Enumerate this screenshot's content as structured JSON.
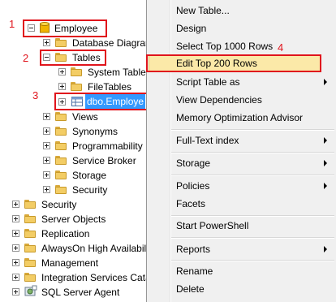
{
  "tree": {
    "employee_db": "Employee",
    "database_diagrams": "Database Diagram",
    "tables": "Tables",
    "system_tables": "System Table",
    "file_tables": "FileTables",
    "dbo_employee": "dbo.Employe",
    "views": "Views",
    "synonyms": "Synonyms",
    "programmability": "Programmability",
    "service_broker": "Service Broker",
    "storage": "Storage",
    "security_db": "Security",
    "security": "Security",
    "server_objects": "Server Objects",
    "replication": "Replication",
    "alwayson": "AlwaysOn High Availabil",
    "management": "Management",
    "integration_services": "Integration Services Cata",
    "sql_server_agent": "SQL Server Agent"
  },
  "annotations": {
    "n1": "1",
    "n2": "2",
    "n3": "3",
    "n4": "4",
    "color": "#e0141c"
  },
  "menu": {
    "new_table": "New Table...",
    "design": "Design",
    "select_top": "Select Top 1000 Rows",
    "edit_top": "Edit Top 200 Rows",
    "script_table": "Script Table as",
    "view_dependencies": "View Dependencies",
    "memory_advisor": "Memory Optimization Advisor",
    "full_text": "Full-Text index",
    "storage": "Storage",
    "policies": "Policies",
    "facets": "Facets",
    "powershell": "Start PowerShell",
    "reports": "Reports",
    "rename": "Rename",
    "delete": "Delete"
  },
  "colors": {
    "highlight": "#fbe9a8",
    "selection": "#3399ff",
    "folder": "#f3cd65"
  }
}
